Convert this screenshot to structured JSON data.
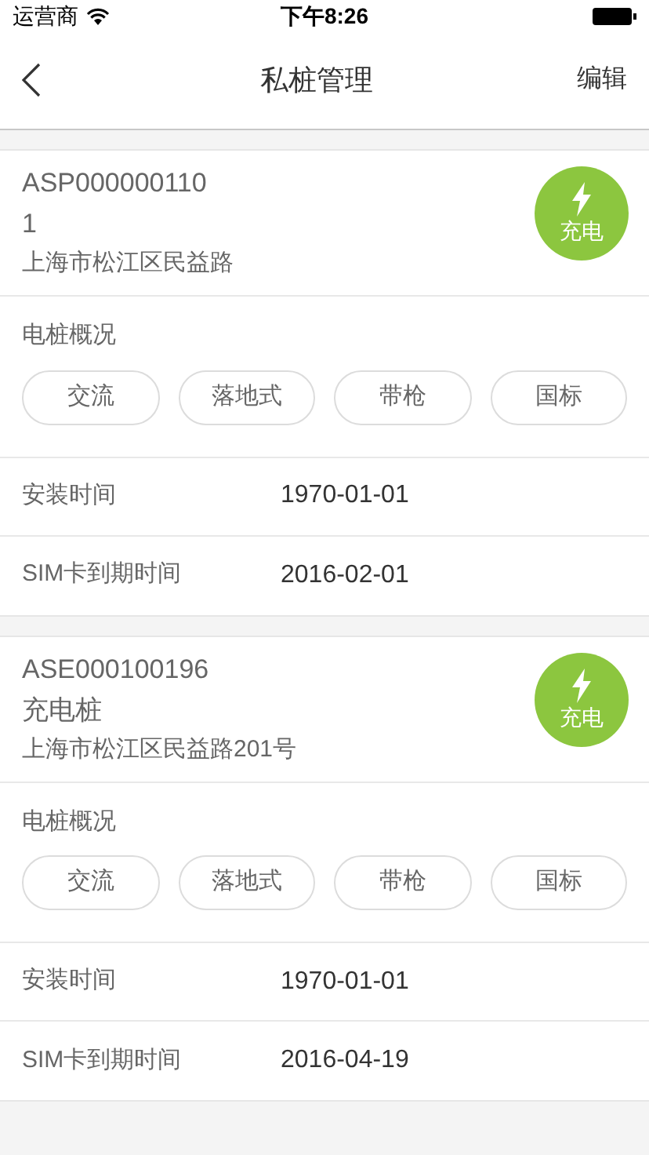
{
  "status_bar": {
    "carrier": "运营商",
    "time": "下午8:26"
  },
  "nav": {
    "title": "私桩管理",
    "action": "编辑"
  },
  "piles": [
    {
      "id_lines": [
        "ASP000000110",
        "1"
      ],
      "address": "上海市松江区民益路",
      "badge": {
        "kind": "charging",
        "label": "充电"
      },
      "overview_label": "电桩概况",
      "tags": [
        "交流",
        "落地式",
        "带枪",
        "国标"
      ],
      "rows": [
        {
          "label": "安装时间",
          "value": "1970-01-01"
        },
        {
          "label": "SIM卡到期时间",
          "value": "2016-02-01"
        }
      ]
    },
    {
      "id_lines": [
        "ASE000100196",
        "充电桩"
      ],
      "address": "上海市松江区民益路201号",
      "badge": {
        "kind": "charging",
        "label": "充电"
      },
      "overview_label": "电桩概况",
      "tags": [
        "交流",
        "落地式",
        "带枪",
        "国标"
      ],
      "rows": [
        {
          "label": "安装时间",
          "value": "1970-01-01"
        },
        {
          "label": "SIM卡到期时间",
          "value": "2016-04-19"
        }
      ]
    }
  ]
}
